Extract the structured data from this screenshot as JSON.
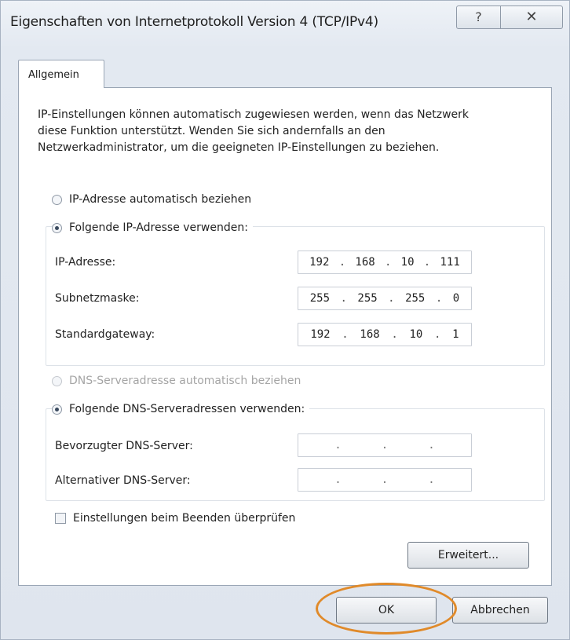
{
  "window": {
    "title": "Eigenschaften von Internetprotokoll Version 4 (TCP/IPv4)",
    "help_glyph": "?",
    "close_glyph": "✕"
  },
  "tab": {
    "label": "Allgemein"
  },
  "intro_text": "IP-Einstellungen können automatisch zugewiesen werden, wenn das Netzwerk diese Funktion unterstützt. Wenden Sie sich andernfalls an den Netzwerkadministrator, um die geeigneten IP-Einstellungen zu beziehen.",
  "ip_mode": {
    "auto_label": "IP-Adresse automatisch beziehen",
    "manual_label": "Folgende IP-Adresse verwenden:",
    "selected": "manual"
  },
  "ip_fields": [
    {
      "label": "IP-Adresse:",
      "octets": [
        "192",
        "168",
        "10",
        "111"
      ]
    },
    {
      "label": "Subnetzmaske:",
      "octets": [
        "255",
        "255",
        "255",
        "0"
      ]
    },
    {
      "label": "Standardgateway:",
      "octets": [
        "192",
        "168",
        "10",
        "1"
      ]
    }
  ],
  "dns_mode": {
    "auto_label": "DNS-Serveradresse automatisch beziehen",
    "manual_label": "Folgende DNS-Serveradressen verwenden:",
    "selected": "manual"
  },
  "dns_fields": [
    {
      "label": "Bevorzugter DNS-Server:",
      "octets": [
        "",
        "",
        "",
        ""
      ]
    },
    {
      "label": "Alternativer DNS-Server:",
      "octets": [
        "",
        "",
        "",
        ""
      ]
    }
  ],
  "validate_on_exit": {
    "label": "Einstellungen beim Beenden überprüfen",
    "checked": false
  },
  "buttons": {
    "advanced": "Erweitert...",
    "ok": "OK",
    "cancel": "Abbrechen"
  },
  "colors": {
    "highlight": "#e08a2a"
  }
}
